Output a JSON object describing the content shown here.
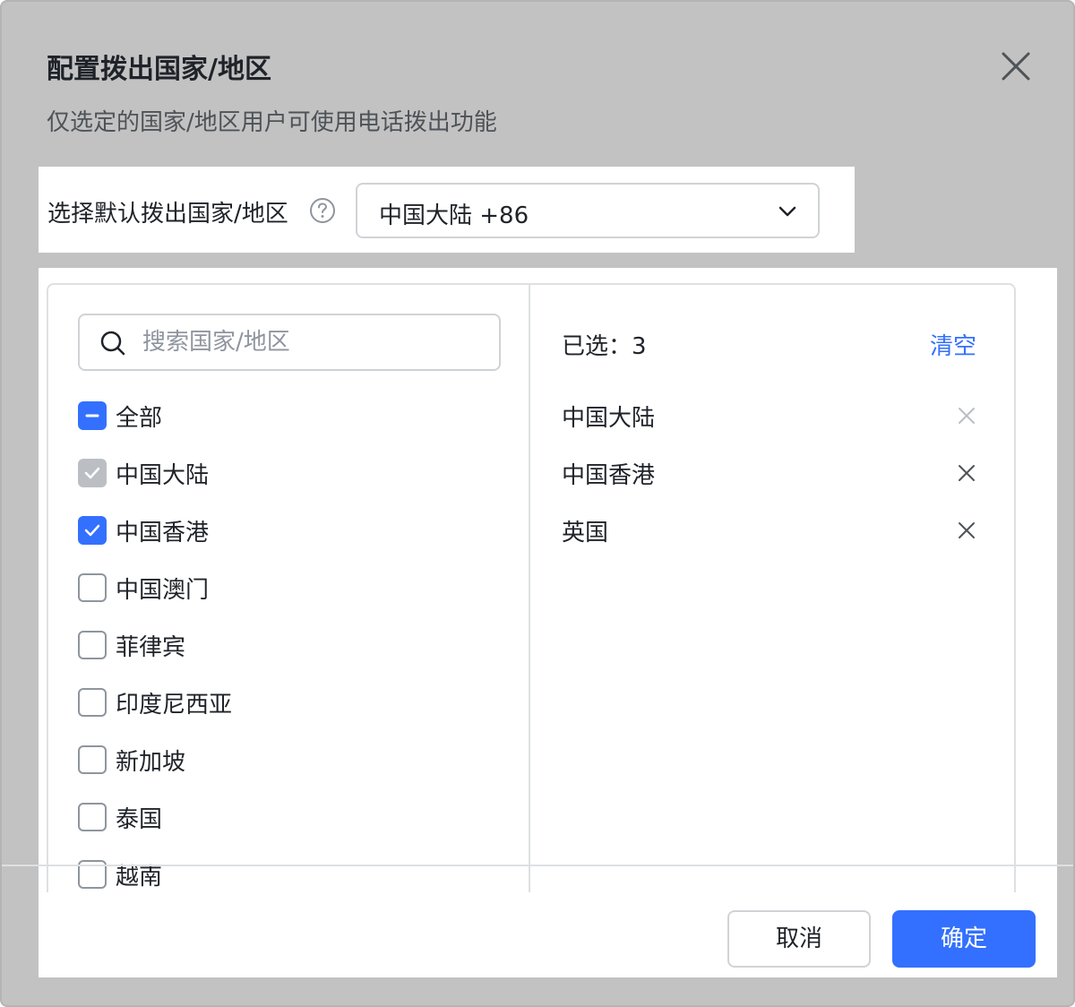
{
  "dialog": {
    "title": "配置拨出国家/地区",
    "subtitle": "仅选定的国家/地区用户可使用电话拨出功能"
  },
  "default_country": {
    "label": "选择默认拨出国家/地区",
    "value": "中国大陆 +86"
  },
  "search": {
    "placeholder": "搜索国家/地区"
  },
  "options": [
    {
      "label": "全部",
      "state": "indeterminate"
    },
    {
      "label": "中国大陆",
      "state": "checked-disabled"
    },
    {
      "label": "中国香港",
      "state": "checked"
    },
    {
      "label": "中国澳门",
      "state": "unchecked"
    },
    {
      "label": "菲律宾",
      "state": "unchecked"
    },
    {
      "label": "印度尼西亚",
      "state": "unchecked"
    },
    {
      "label": "新加坡",
      "state": "unchecked"
    },
    {
      "label": "泰国",
      "state": "unchecked"
    },
    {
      "label": "越南",
      "state": "unchecked"
    }
  ],
  "selected": {
    "count_label": "已选：3",
    "clear_label": "清空",
    "items": [
      {
        "label": "中国大陆"
      },
      {
        "label": "中国香港"
      },
      {
        "label": "英国"
      }
    ]
  },
  "footer": {
    "cancel_label": "取消",
    "ok_label": "确定"
  },
  "colors": {
    "primary": "#3370ff",
    "overlay": "#c2c2c2"
  }
}
